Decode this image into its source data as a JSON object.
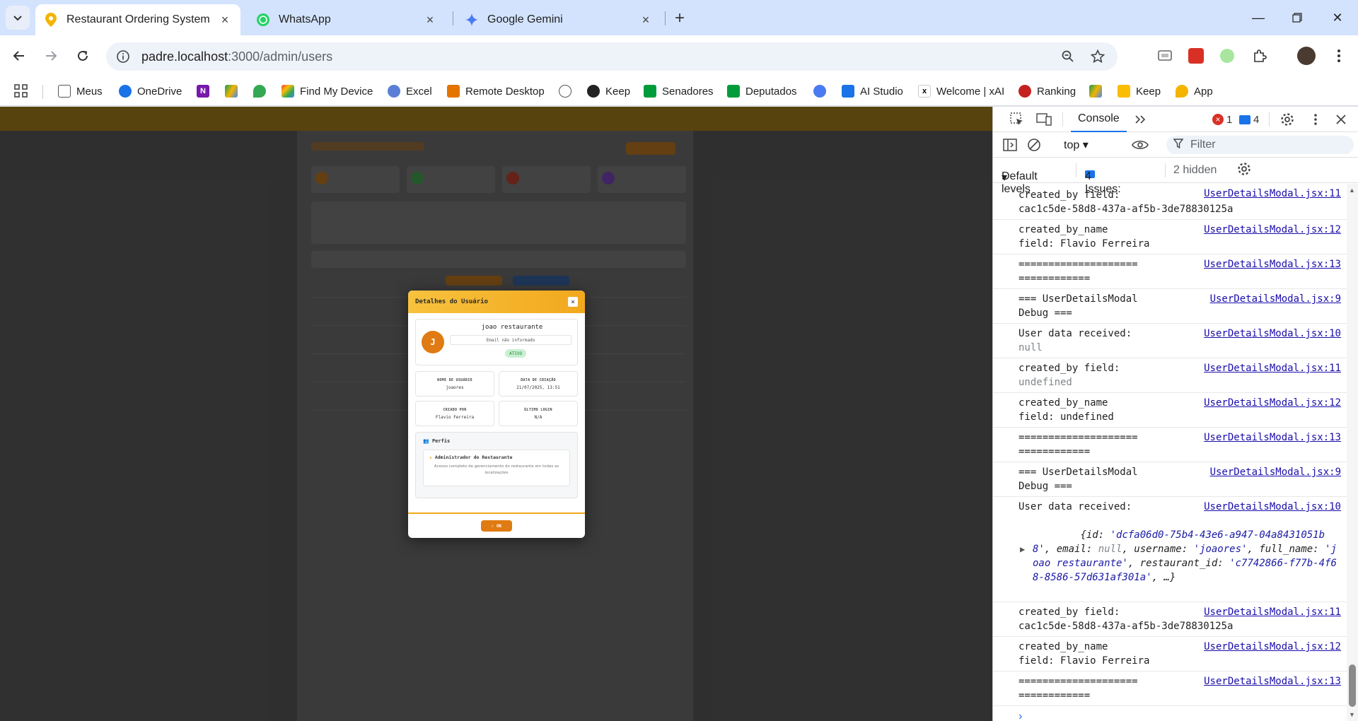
{
  "browser": {
    "tabs": [
      {
        "title": "Restaurant Ordering System",
        "active": true
      },
      {
        "title": "WhatsApp",
        "active": false
      },
      {
        "title": "Google Gemini",
        "active": false
      }
    ],
    "url_host": "padre.localhost",
    "url_rest": ":3000/admin/users",
    "bookmarks": [
      "Meus",
      "OneDrive",
      "Find My Device",
      "Excel",
      "Remote Desktop",
      "Keep",
      "Senadores",
      "Deputados",
      "AI Studio",
      "Welcome | xAI",
      "Ranking",
      "Keep",
      "App"
    ]
  },
  "modal": {
    "title": "Detalhes do Usuário",
    "close": "×",
    "avatar_letter": "J",
    "full_name": "joao restaurante",
    "email": "Email não informado",
    "status": "ATIVO",
    "fields": [
      {
        "label": "NOME DE USUÁRIO",
        "value": "joaores"
      },
      {
        "label": "DATA DE CRIAÇÃO",
        "value": "21/07/2025, 13:51"
      },
      {
        "label": "CRIADO POR",
        "value": "Flavio Ferreira"
      },
      {
        "label": "ÚLTIMO LOGIN",
        "value": "N/A"
      }
    ],
    "profiles_title": "Perfis",
    "role_name": "Administrador do Restaurante",
    "role_desc": "Acesso completo de gerenciamento do restaurante em todas as localizações",
    "ok": "✓ OK"
  },
  "devtools": {
    "console_tab": "Console",
    "errors": "1",
    "warnings": "4",
    "context": "top",
    "filter_placeholder": "Filter",
    "levels": "Default levels",
    "issues": "4 Issues:",
    "issues_count": "4",
    "hidden": "2 hidden",
    "logs": [
      {
        "msg": "created_by field:",
        "cont": "cac1c5de-58d8-437a-af5b-3de78830125a",
        "src": "UserDetailsModal.jsx:11"
      },
      {
        "msg": "created_by_name",
        "cont": "field: Flavio Ferreira",
        "src": "UserDetailsModal.jsx:12"
      },
      {
        "msg": "====================",
        "cont": "============",
        "src": "UserDetailsModal.jsx:13"
      },
      {
        "msg": "=== UserDetailsModal",
        "cont": "Debug ===",
        "src": "UserDetailsModal.jsx:9"
      },
      {
        "msg": "User data received:",
        "cont": "null",
        "src": "UserDetailsModal.jsx:10"
      },
      {
        "msg": "created_by field:",
        "cont": "undefined",
        "src": "UserDetailsModal.jsx:11"
      },
      {
        "msg": "created_by_name",
        "cont": "field: undefined",
        "src": "UserDetailsModal.jsx:12"
      },
      {
        "msg": "====================",
        "cont": "============",
        "src": "UserDetailsModal.jsx:13"
      },
      {
        "msg": "=== UserDetailsModal",
        "cont": "Debug ===",
        "src": "UserDetailsModal.jsx:9"
      },
      {
        "msg": "User data received:",
        "cont": "",
        "src": "UserDetailsModal.jsx:10"
      },
      {
        "msg": "created_by field:",
        "cont": "cac1c5de-58d8-437a-af5b-3de78830125a",
        "src": "UserDetailsModal.jsx:11"
      },
      {
        "msg": "created_by_name",
        "cont": "field: Flavio Ferreira",
        "src": "UserDetailsModal.jsx:12"
      },
      {
        "msg": "====================",
        "cont": "============",
        "src": "UserDetailsModal.jsx:13"
      }
    ],
    "object_preview": {
      "id": "'dcfa06d0-75b4-43e6-a947-04a8431051b8'",
      "email": "null",
      "username": "'joaores'",
      "full_name": "'joao restaurante'",
      "restaurant_id": "'c7742866-f77b-4f68-8586-57d631af301a'"
    },
    "prompt": "›"
  },
  "colors": {
    "accent_orange": "#e07a12",
    "modal_header": "#f2a81d",
    "link": "#1a0dab"
  }
}
